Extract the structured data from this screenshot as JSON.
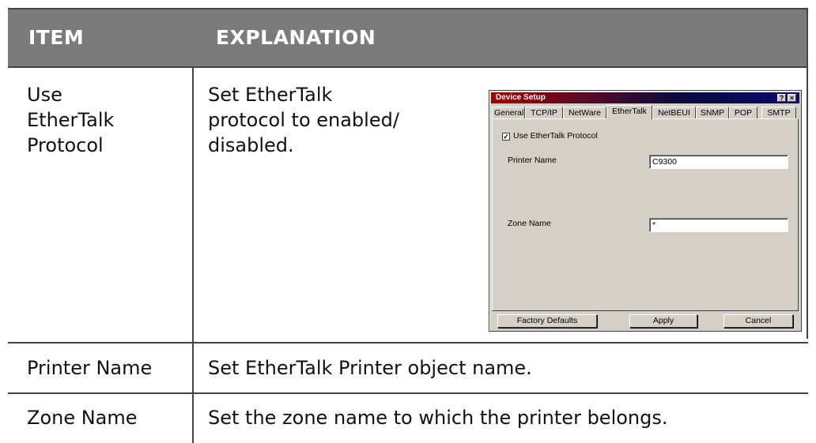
{
  "table": {
    "headers": [
      "ITEM",
      "EXPLANATION"
    ],
    "rows": [
      {
        "item": [
          "Use",
          "EtherTalk",
          "Protocol"
        ],
        "explanation": [
          "Set EtherTalk",
          "protocol to enabled/",
          "disabled."
        ]
      },
      {
        "item": [
          "Printer Name"
        ],
        "explanation": [
          "Set EtherTalk Printer object name."
        ]
      },
      {
        "item": [
          "Zone Name"
        ],
        "explanation": [
          "Set the zone name to which the printer belongs."
        ]
      }
    ]
  },
  "dialog": {
    "title": "Device Setup",
    "help_button": "?",
    "close_button": "×",
    "tabs": [
      "General",
      "TCP/IP",
      "NetWare",
      "EtherTalk",
      "NetBEUI",
      "SNMP",
      "POP",
      "SMTP"
    ],
    "active_tab": "EtherTalk",
    "use_ethertalk_label": "Use EtherTalk Protocol",
    "use_ethertalk_checked": true,
    "printer_name_label": "Printer Name",
    "printer_name_value": "C9300",
    "zone_name_label": "Zone Name",
    "zone_name_value": "*",
    "buttons": {
      "factory_defaults": "Factory Defaults",
      "apply": "Apply",
      "cancel": "Cancel"
    }
  },
  "colors": {
    "header_bg": "#7b7b7b",
    "header_text": "#ffffff",
    "rule": "#444444",
    "dialog_bg": "#d4d0c8"
  }
}
